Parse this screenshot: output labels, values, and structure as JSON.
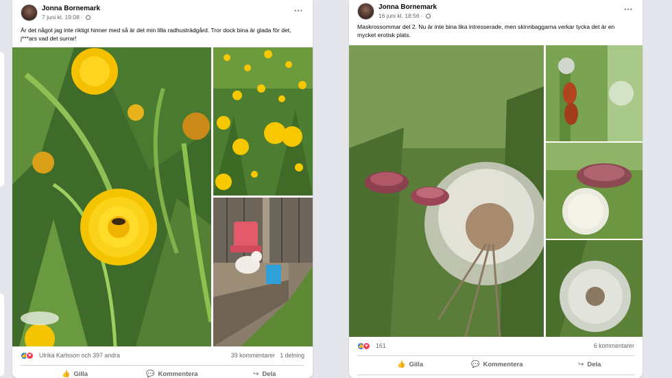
{
  "post1": {
    "author": "Jonna Bornemark",
    "date": "7 juni kl. 19:08",
    "separator": "·",
    "text": "Är det något jag inte riktigt hinner med så är det min lilla radhusträdgård. Tror dock bina är glada för det, j***ars vad det surrar!",
    "reactions_names": "Ulrika Karlsson och 397 andra",
    "comments": "39 kommentarer",
    "shares": "1 delning",
    "like_label": "Gilla",
    "comment_label": "Kommentera",
    "share_label": "Dela"
  },
  "post2": {
    "author": "Jonna Bornemark",
    "date": "16 juni kl. 18:56",
    "separator": "·",
    "text": "Maskrossommar del 2. Nu är inte bina lika intresserade, men skinnbaggarna verkar tycka det är en mycket erotisk plats.",
    "reaction_count": "161",
    "comments": "6 kommentarer",
    "like_label": "Gilla",
    "comment_label": "Kommentera",
    "share_label": "Dela"
  },
  "icons": {
    "more": "more-horizontal-icon",
    "globe": "globe-icon",
    "like": "thumbs-up-icon",
    "love": "heart-icon",
    "comment": "speech-bubble-icon",
    "share": "share-arrow-icon"
  },
  "colors": {
    "like_blue": "#1877f2",
    "love_red": "#f33e58",
    "secondary_text": "#65676b",
    "background": "#e4e6eb"
  }
}
